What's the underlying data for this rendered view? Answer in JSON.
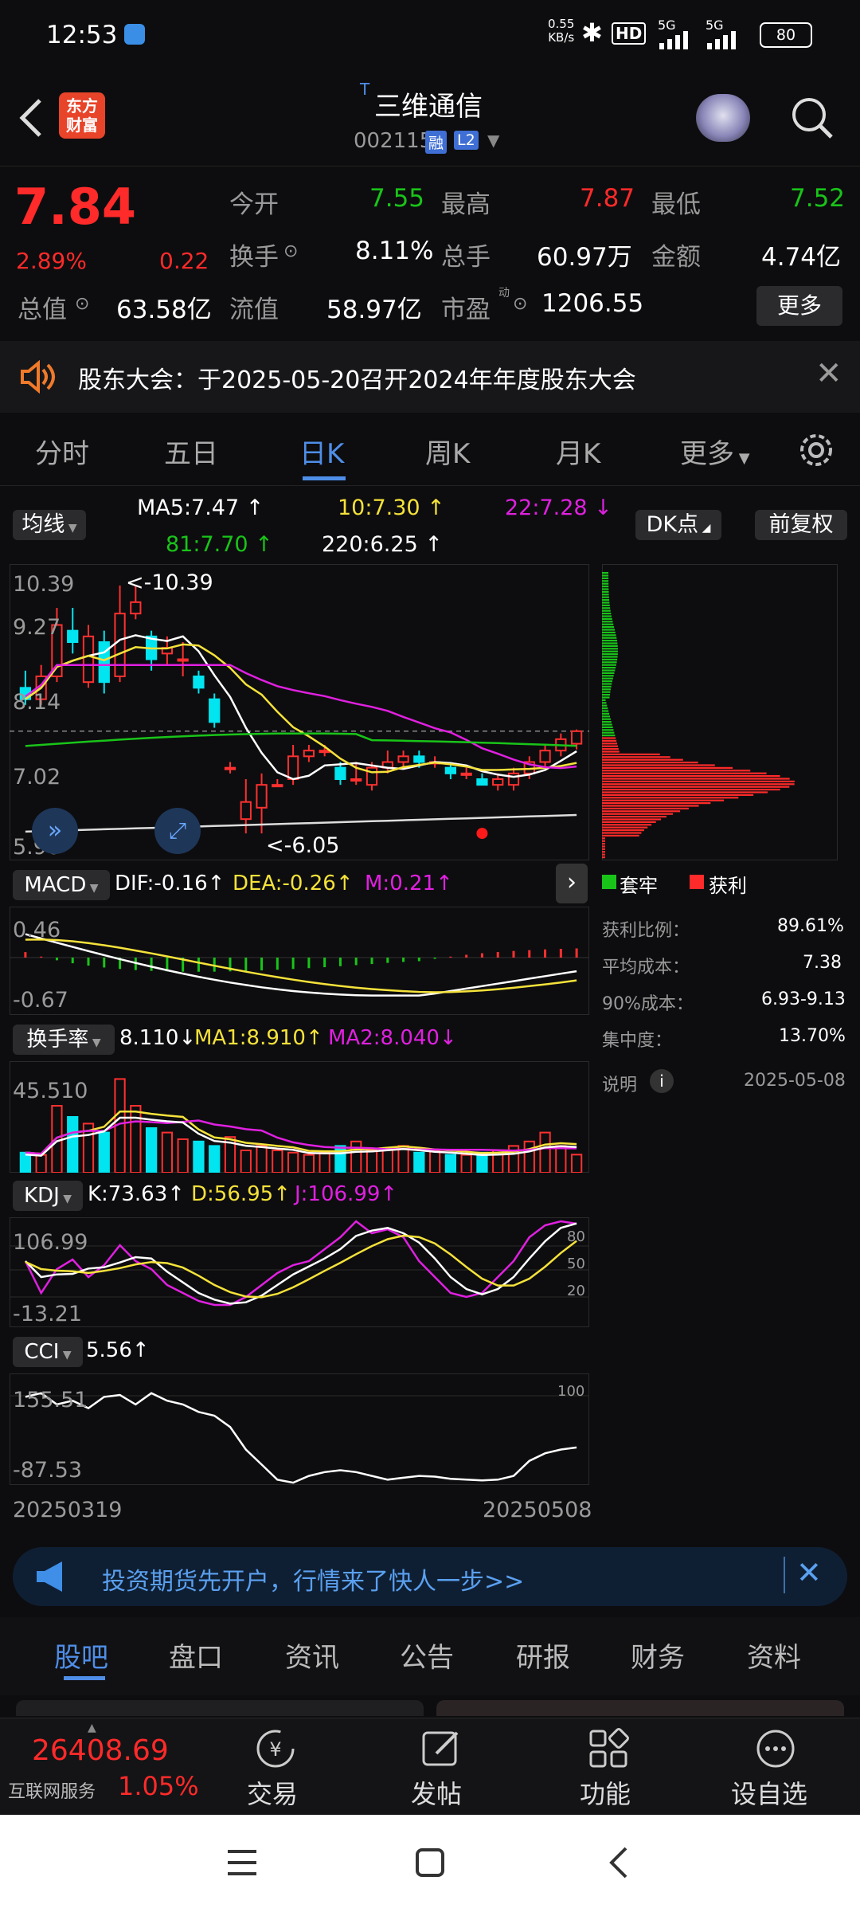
{
  "status": {
    "time": "12:53",
    "net_speed": "0.55",
    "net_unit": "KB/s",
    "hd": "HD",
    "sig1": "5G",
    "sig2": "5G",
    "battery": "80"
  },
  "header": {
    "title": "三维通信",
    "title_prefix": "T",
    "code": "002115",
    "badge1": "融",
    "badge2": "L2",
    "logo_line1": "东方",
    "logo_line2": "财富"
  },
  "quote": {
    "price": "7.84",
    "pct": "2.89%",
    "change": "0.22",
    "open_label": "今开",
    "open": "7.55",
    "high_label": "最高",
    "high": "7.87",
    "low_label": "最低",
    "low": "7.52",
    "turnover_label": "换手",
    "turnover": "8.11%",
    "volume_label": "总手",
    "volume": "60.97万",
    "amount_label": "金额",
    "amount": "4.74亿",
    "mcap_label": "总值",
    "mcap": "63.58亿",
    "float_label": "流值",
    "float": "58.97亿",
    "pe_label": "市盈",
    "pe_sup": "动",
    "pe": "1206.55",
    "more": "更多"
  },
  "notice": {
    "text": "股东大会：于2025-05-20召开2024年年度股东大会"
  },
  "tabs": [
    {
      "label": "分时"
    },
    {
      "label": "五日"
    },
    {
      "label": "日K"
    },
    {
      "label": "周K"
    },
    {
      "label": "月K"
    },
    {
      "label": "更多"
    }
  ],
  "kline": {
    "ma_selector": "均线",
    "ma5": "MA5:7.47",
    "ma10": "10:7.30",
    "ma22": "22:7.28",
    "ma81": "81:7.70",
    "ma220": "220:6.25",
    "dk_button": "DK点",
    "fq_button": "前复权",
    "y_labels": [
      "10.39",
      "9.27",
      "8.14",
      "7.02",
      "5.90"
    ],
    "max_note": "<-10.39",
    "min_note": "<-6.05",
    "candles": [
      {
        "o": 8.6,
        "c": 8.4,
        "h": 8.9,
        "l": 8.3
      },
      {
        "o": 8.4,
        "c": 8.8,
        "h": 9.0,
        "l": 8.3
      },
      {
        "o": 8.8,
        "c": 9.7,
        "h": 10.0,
        "l": 8.7
      },
      {
        "o": 9.6,
        "c": 9.4,
        "h": 10.0,
        "l": 9.2
      },
      {
        "o": 8.7,
        "c": 9.5,
        "h": 9.7,
        "l": 8.6
      },
      {
        "o": 9.4,
        "c": 8.7,
        "h": 9.6,
        "l": 8.5
      },
      {
        "o": 8.8,
        "c": 9.9,
        "h": 10.39,
        "l": 8.7
      },
      {
        "o": 9.9,
        "c": 10.1,
        "h": 10.39,
        "l": 9.8
      },
      {
        "o": 9.5,
        "c": 9.1,
        "h": 9.6,
        "l": 8.9
      },
      {
        "o": 9.2,
        "c": 9.3,
        "h": 9.5,
        "l": 9.0
      },
      {
        "o": 9.1,
        "c": 9.1,
        "h": 9.4,
        "l": 8.8
      },
      {
        "o": 8.8,
        "c": 8.6,
        "h": 8.9,
        "l": 8.5
      },
      {
        "o": 8.4,
        "c": 8.0,
        "h": 8.5,
        "l": 7.9
      },
      {
        "o": 7.2,
        "c": 7.2,
        "h": 7.3,
        "l": 7.1
      },
      {
        "o": 6.3,
        "c": 6.6,
        "h": 7.0,
        "l": 6.05
      },
      {
        "o": 6.5,
        "c": 6.9,
        "h": 7.1,
        "l": 6.05
      },
      {
        "o": 6.9,
        "c": 6.9,
        "h": 7.0,
        "l": 6.9
      },
      {
        "o": 7.0,
        "c": 7.4,
        "h": 7.6,
        "l": 6.9
      },
      {
        "o": 7.4,
        "c": 7.5,
        "h": 7.6,
        "l": 7.3
      },
      {
        "o": 7.5,
        "c": 7.5,
        "h": 7.6,
        "l": 7.4
      },
      {
        "o": 7.2,
        "c": 7.0,
        "h": 7.3,
        "l": 6.9
      },
      {
        "o": 7.0,
        "c": 7.0,
        "h": 7.3,
        "l": 6.9
      },
      {
        "o": 6.9,
        "c": 7.2,
        "h": 7.3,
        "l": 6.8
      },
      {
        "o": 7.2,
        "c": 7.3,
        "h": 7.5,
        "l": 7.1
      },
      {
        "o": 7.3,
        "c": 7.4,
        "h": 7.5,
        "l": 7.2
      },
      {
        "o": 7.4,
        "c": 7.3,
        "h": 7.5,
        "l": 7.2
      },
      {
        "o": 7.3,
        "c": 7.3,
        "h": 7.4,
        "l": 7.2
      },
      {
        "o": 7.2,
        "c": 7.1,
        "h": 7.3,
        "l": 7.0
      },
      {
        "o": 7.1,
        "c": 7.1,
        "h": 7.2,
        "l": 7.0
      },
      {
        "o": 7.0,
        "c": 6.9,
        "h": 7.1,
        "l": 6.9
      },
      {
        "o": 6.9,
        "c": 7.0,
        "h": 7.1,
        "l": 6.8
      },
      {
        "o": 6.9,
        "c": 7.1,
        "h": 7.2,
        "l": 6.8
      },
      {
        "o": 7.1,
        "c": 7.3,
        "h": 7.4,
        "l": 7.0
      },
      {
        "o": 7.3,
        "c": 7.5,
        "h": 7.6,
        "l": 7.2
      },
      {
        "o": 7.5,
        "c": 7.7,
        "h": 7.8,
        "l": 7.4
      },
      {
        "o": 7.62,
        "c": 7.84,
        "h": 7.87,
        "l": 7.52
      }
    ]
  },
  "chip": {
    "legend_loss": "套牢",
    "legend_profit": "获利",
    "rows": [
      {
        "label": "获利比例：",
        "value": "89.61%"
      },
      {
        "label": "平均成本：",
        "value": "7.38"
      },
      {
        "label": "90%成本：",
        "value": "6.93-9.13"
      },
      {
        "label": "集中度：",
        "value": "13.70%"
      }
    ],
    "note_label": "说明",
    "date": "2025-05-08"
  },
  "macd": {
    "selector": "MACD",
    "dif": "DIF:-0.16",
    "dea": "DEA:-0.26",
    "m": "M:0.21",
    "y_top": "0.46",
    "y_bottom": "-0.67"
  },
  "turnover_ind": {
    "selector": "换手率",
    "val": "8.110",
    "ma1": "MA1:8.910",
    "ma2": "MA2:8.040",
    "y_top": "45.510"
  },
  "kdj": {
    "selector": "KDJ",
    "k": "K:73.63",
    "d": "D:56.95",
    "j": "J:106.99",
    "y_top": "106.99",
    "y_bottom": "-13.21",
    "lvl80": "80",
    "lvl50": "50",
    "lvl20": "20"
  },
  "cci": {
    "selector": "CCI",
    "val": "5.56",
    "y_top": "155.51",
    "y_bottom": "-87.53",
    "lvl100": "100"
  },
  "dates": {
    "start": "20250319",
    "end": "20250508"
  },
  "ad": {
    "text": "投资期货先开户，行情来了快人一步>>"
  },
  "bottom_tabs": [
    {
      "label": "股吧"
    },
    {
      "label": "盘口"
    },
    {
      "label": "资讯"
    },
    {
      "label": "公告"
    },
    {
      "label": "研报"
    },
    {
      "label": "财务"
    },
    {
      "label": "资料"
    }
  ],
  "dock": {
    "index_value": "26408.69",
    "index_name": "互联网服务",
    "index_pct": "1.05%",
    "trade": "交易",
    "post": "发帖",
    "func": "功能",
    "watch": "设自选"
  }
}
